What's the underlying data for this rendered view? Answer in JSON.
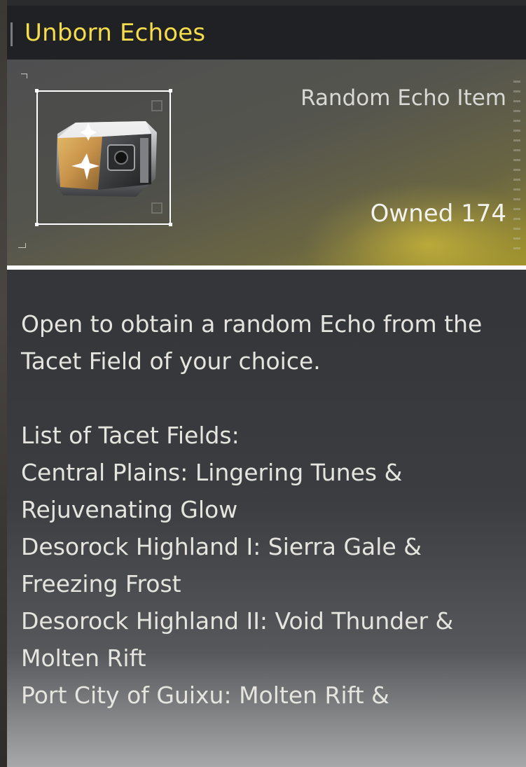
{
  "item": {
    "title": "Unborn Echoes",
    "type": "Random Echo Item",
    "owned": "Owned 174",
    "icon": "echo-chest-icon",
    "accent_color": "#f4dc4b"
  },
  "description": {
    "intro_line1": "Open to obtain a random Echo from the",
    "intro_line2": "Tacet Field of your choice.",
    "list_heading": "List of Tacet Fields:",
    "lines": [
      "Central Plains: Lingering Tunes &",
      "Rejuvenating Glow",
      "Desorock Highland I: Sierra Gale &",
      "Freezing Frost",
      "Desorock Highland II: Void Thunder &",
      "Molten Rift",
      "Port City of Guixu: Molten Rift &"
    ]
  }
}
